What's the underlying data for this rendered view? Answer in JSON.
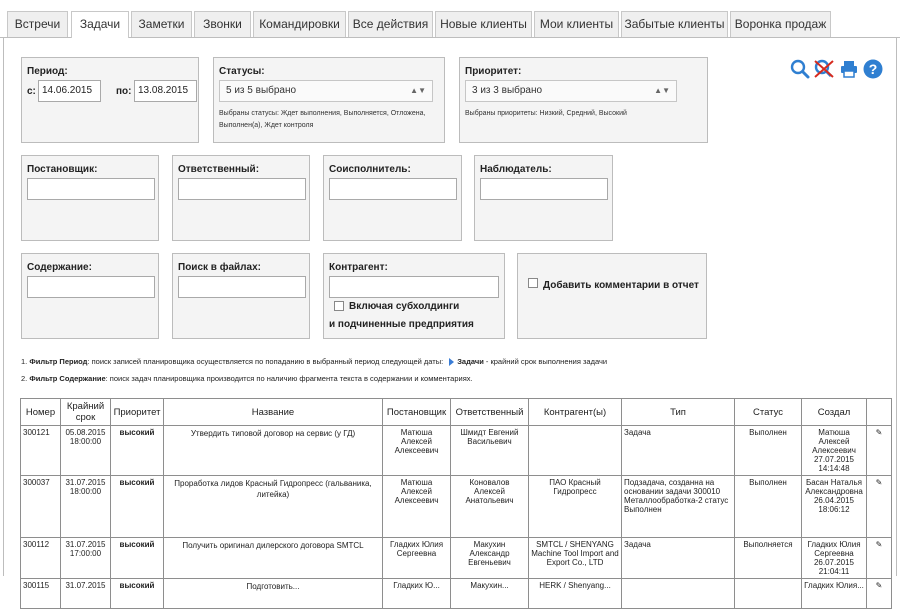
{
  "tabs": [
    "Встречи",
    "Задачи",
    "Заметки",
    "Звонки",
    "Командировки",
    "Все действия",
    "Новые клиенты",
    "Мои клиенты",
    "Забытые клиенты",
    "Воронка продаж"
  ],
  "active_tab": "Задачи",
  "filters": {
    "period": {
      "label": "Период:",
      "from_label": "с:",
      "from": "14.06.2015",
      "to_label": "по:",
      "to": "13.08.2015"
    },
    "statuses": {
      "label": "Статусы:",
      "selected": "5 из 5 выбрано",
      "note": "Выбраны статусы: Ждет выполнения, Выполняется, Отложена, Выполнен(а), Ждет контроля"
    },
    "priority": {
      "label": "Приоритет:",
      "selected": "3 из 3 выбрано",
      "note": "Выбраны приоритеты: Низкий, Средний, Высокий"
    },
    "setter": {
      "label": "Постановщик:",
      "value": ""
    },
    "responsible": {
      "label": "Ответственный:",
      "value": ""
    },
    "coexecutor": {
      "label": "Соисполнитель:",
      "value": ""
    },
    "observer": {
      "label": "Наблюдатель:",
      "value": ""
    },
    "content": {
      "label": "Содержание:",
      "value": ""
    },
    "file_search": {
      "label": "Поиск в файлах:",
      "value": ""
    },
    "contractor": {
      "label": "Контрагент:",
      "value": "",
      "include_line1": "Включая субхолдинги",
      "include_line2": "и подчиненные предприятия"
    },
    "add_comments": "Добавить комментарии в отчет"
  },
  "footnotes": {
    "n1_num": "1.",
    "n1_bold": "Фильтр Период",
    "n1_text": ": поиск записей планировщика осуществляется по попаданию в выбранный период следующей даты:",
    "n1_link": "Задачи",
    "n1_tail": " - крайний срок выполнения задачи",
    "n2_num": "2.",
    "n2_bold": "Фильтр Содержание",
    "n2_text": ": поиск задач планировщика производится по наличию фрагмента текста в содержании и комментариях."
  },
  "table": {
    "headers": [
      "Номер",
      "Крайний срок",
      "Приоритет",
      "Название",
      "Постановщик",
      "Ответственный",
      "Контрагент(ы)",
      "Тип",
      "Статус",
      "Создал"
    ],
    "rows": [
      {
        "num": "300121",
        "due": "05.08.2015 18:00:00",
        "priority": "высокий",
        "name": "Утвердить типовой договор на сервис (у ГД)",
        "setter": "Матюша Алексей Алексеевич",
        "responsible": "Шмидт Евгений Васильевич",
        "contractor": "",
        "type": "Задача",
        "status": "Выполнен",
        "created": "Матюша Алексей Алексеевич 27.07.2015 14:14:48"
      },
      {
        "num": "300037",
        "due": "31.07.2015 18:00:00",
        "priority": "высокий",
        "name": "Проработка лидов Красный Гидропресс (гальваника, литейка)",
        "setter": "Матюша Алексей Алексеевич",
        "responsible": "Коновалов Алексей Анатольевич",
        "contractor": "ПАО Красный Гидропресс",
        "type": "Подзадача, созданна на основании задачи 300010 Металлообработка-2 статус Выполнен",
        "status": "Выполнен",
        "created": "Басан Наталья Александровна 26.04.2015 18:06:12"
      },
      {
        "num": "300112",
        "due": "31.07.2015 17:00:00",
        "priority": "высокий",
        "name": "Получить оригинал дилерского договора SMTCL",
        "setter": "Гладких Юлия Сергеевна",
        "responsible": "Макухин Александр Евгеньевич",
        "contractor": "SMTCL / SHENYANG Machine Tool Import and Export Co., LTD",
        "type": "Задача",
        "status": "Выполняется",
        "created": "Гладких Юлия Сергеевна 26.07.2015 21:04:11"
      },
      {
        "num": "300115",
        "due": "31.07.2015",
        "priority": "высокий",
        "name": "Подготовить...",
        "setter": "Гладких Ю...",
        "responsible": "Макухин...",
        "contractor": "HERK / Shenyang...",
        "type": "",
        "status": "",
        "created": "Гладких Юлия..."
      }
    ]
  },
  "colors": {
    "priority_high": "#d9281b",
    "accent": "#3a7dd6"
  }
}
